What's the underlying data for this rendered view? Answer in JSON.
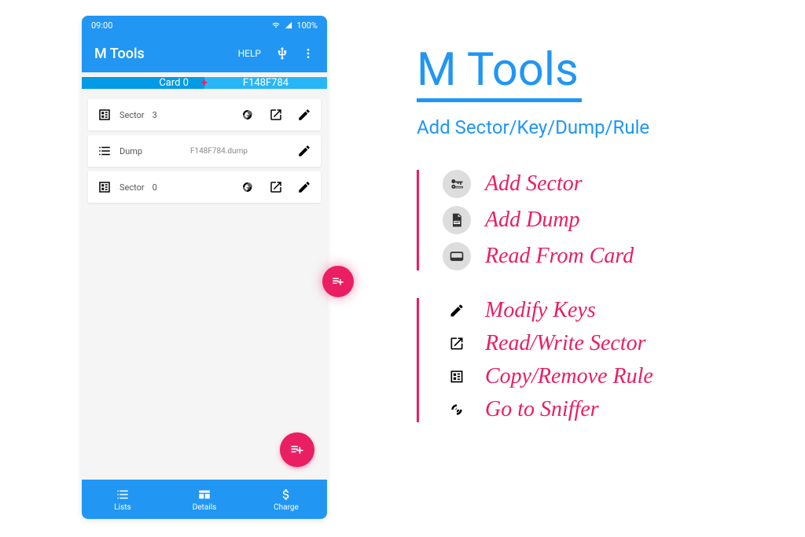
{
  "status": {
    "time": "09:00",
    "battery": "100%"
  },
  "appbar": {
    "title": "M Tools",
    "help": "HELP"
  },
  "card_header": {
    "left": "Card 0",
    "right": "F148F784"
  },
  "rows": [
    {
      "label": "Sector",
      "num": "3"
    },
    {
      "label": "Dump",
      "info": "F148F784.dump"
    },
    {
      "label": "Sector",
      "num": "0"
    }
  ],
  "bottom_nav": {
    "lists": "Lists",
    "details": "Details",
    "charge": "Charge"
  },
  "right": {
    "title": "M Tools",
    "subtitle": "Add Sector/Key/Dump/Rule",
    "group1": [
      {
        "label": "Add Sector"
      },
      {
        "label": "Add Dump"
      },
      {
        "label": "Read From Card"
      }
    ],
    "group2": [
      {
        "label": "Modify Keys"
      },
      {
        "label": "Read/Write Sector"
      },
      {
        "label": "Copy/Remove Rule"
      },
      {
        "label": "Go to Sniffer"
      }
    ]
  }
}
